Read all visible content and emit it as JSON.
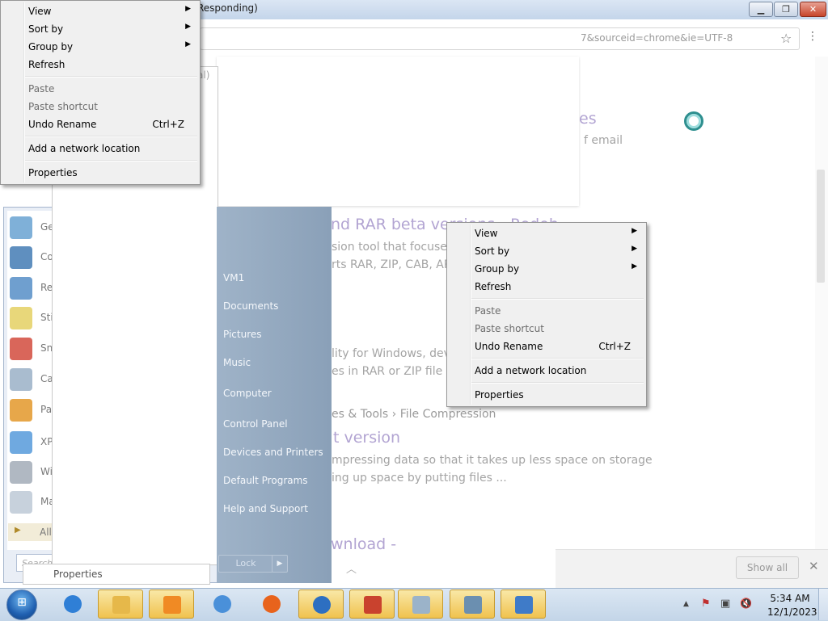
{
  "browser": {
    "title_fragment": "Responding)",
    "title_subfragment": "",
    "address_fragment": "7&sourceid=chrome&ie=UTF-8",
    "star_icon": "☆",
    "menu_icon": "⋮",
    "results": {
      "t1_title_end": "es",
      "t1_snippet_end": "f email",
      "t2_title": "nd RAR beta versions - Redoh",
      "t2_line1": "sion tool that focuses o",
      "t2_line2": "rts RAR, ZIP, CAB, AR",
      "t3_line1": "lity for Windows, devel",
      "t3_line2": "es in RAR or ZIP file ...",
      "t4_breadcrumb": "es & Tools › File Compression",
      "t4_title": "t version",
      "t4_line1": "mpressing data so that it takes up less space on storage",
      "t4_line2": "ing up space by putting files ...",
      "t5_title": "wnload -"
    },
    "show_all": "Show all",
    "close_glyph": "✕"
  },
  "window_buttons": {
    "minimize": "▁",
    "maximize": "❐",
    "close": "✕"
  },
  "start_menu": {
    "programs": [
      {
        "label": "Ge"
      },
      {
        "label": "Co"
      },
      {
        "label": "Re"
      },
      {
        "label": "Sti"
      },
      {
        "label": "Sn"
      },
      {
        "label": "Ca"
      },
      {
        "label": "Pa"
      },
      {
        "label": "XP"
      },
      {
        "label": "Wi"
      },
      {
        "label": "Ma"
      }
    ],
    "all_programs": "All",
    "search_placeholder": "Search",
    "panel_fragment": "al)",
    "right_items": [
      "VM1",
      "Documents",
      "Pictures",
      "Music",
      "Computer",
      "Control Panel",
      "Devices and Printers",
      "Default Programs",
      "Help and Support"
    ],
    "lock": "Lock",
    "lock_arrow": "▶",
    "properties_strip": "Properties",
    "chevron": "︿"
  },
  "context_menu": {
    "items": [
      {
        "label": "View",
        "submenu": true
      },
      {
        "label": "Sort by",
        "submenu": true
      },
      {
        "label": "Group by",
        "submenu": true
      },
      {
        "label": "Refresh"
      },
      {
        "label": "Paste",
        "disabled": true
      },
      {
        "label": "Paste shortcut",
        "disabled": true
      },
      {
        "label": "Undo Rename",
        "shortcut": "Ctrl+Z"
      },
      {
        "label": "Add a network location"
      },
      {
        "label": "Properties"
      }
    ],
    "arrow": "▶"
  },
  "taskbar": {
    "start_glyph": "⊞",
    "apps": [
      {
        "name": "internet-explorer",
        "color": "#2f7fd6"
      },
      {
        "name": "file-explorer",
        "color": "#e6b84a"
      },
      {
        "name": "media-player",
        "color": "#f08a24"
      },
      {
        "name": "chrome",
        "color": "#4a90d9"
      },
      {
        "name": "firefox",
        "color": "#e8631c"
      },
      {
        "name": "thunderbird",
        "color": "#2d6fc1"
      },
      {
        "name": "toolbox",
        "color": "#c9422e"
      },
      {
        "name": "calculator",
        "color": "#9bb3c9"
      },
      {
        "name": "remote-desktop",
        "color": "#6b8fb0"
      },
      {
        "name": "app-window",
        "color": "#3f7bc8"
      }
    ],
    "tray": {
      "chevron": "▲",
      "flag": "⚑",
      "network": "▣",
      "volume": "🔇"
    },
    "time": "5:34 AM",
    "date": "12/1/2023"
  },
  "colors": {
    "accent": "#f0c24e",
    "link": "#b2a4d2",
    "menu_bg": "#f0f0f0"
  }
}
